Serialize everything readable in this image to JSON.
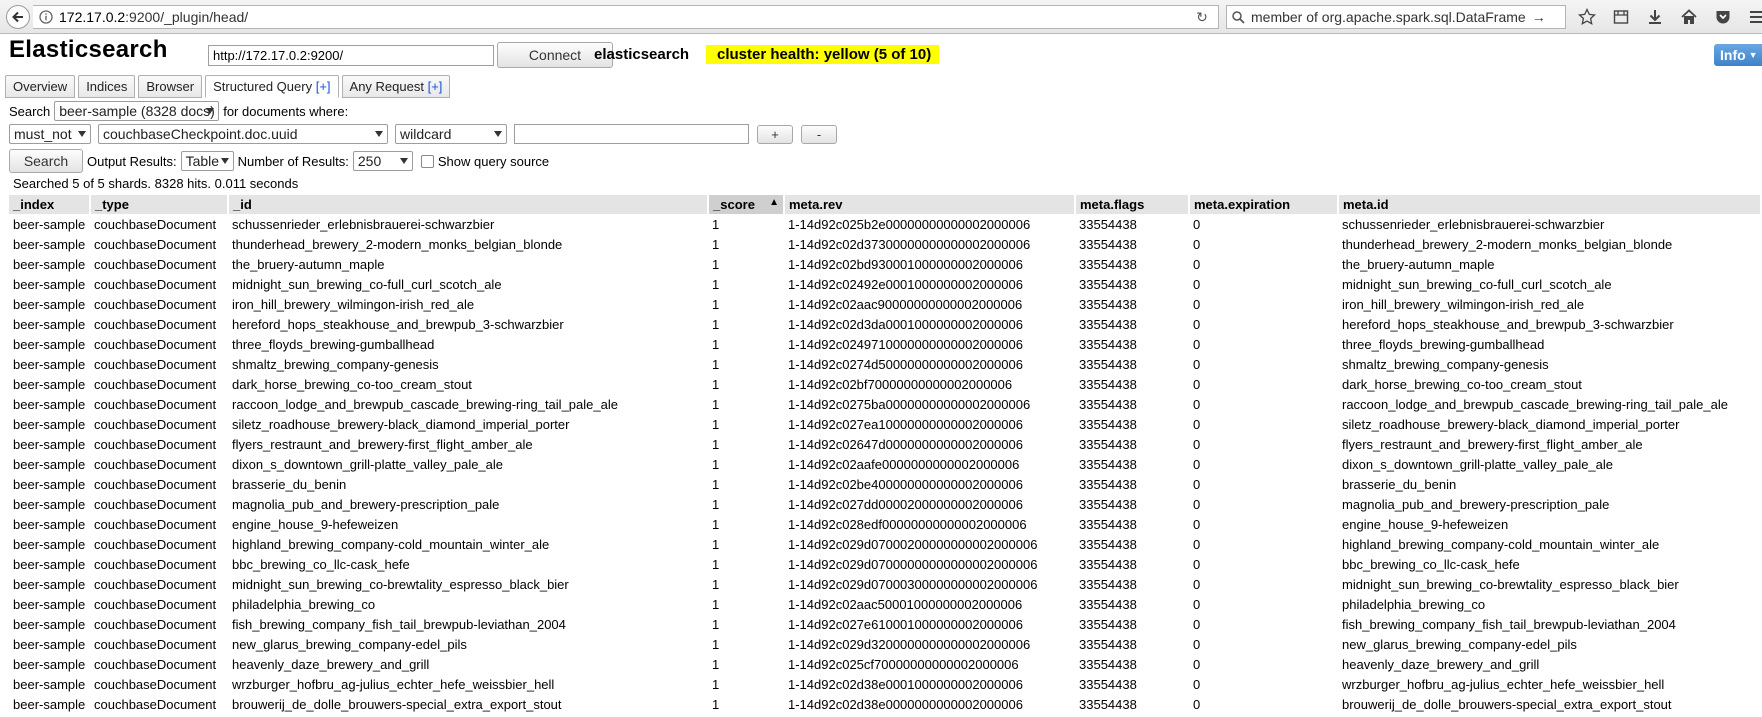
{
  "browser": {
    "url_host": "172.17.0.2",
    "url_rest": ":9200/_plugin/head/",
    "search_text": "member of org.apache.spark.sql.DataFrame",
    "search_arrow": "→"
  },
  "app": {
    "title": "Elasticsearch",
    "connection_url": "http://172.17.0.2:9200/",
    "connect_label": "Connect",
    "cluster_name": "elasticsearch",
    "health_text": "cluster health: yellow (5 of 10)",
    "health_color": "#ffff00",
    "info_label": "Info"
  },
  "tabs": [
    {
      "label": "Overview"
    },
    {
      "label": "Indices"
    },
    {
      "label": "Browser"
    },
    {
      "label": "Structured Query",
      "plus": "[+]"
    },
    {
      "label": "Any Request",
      "plus": "[+]"
    }
  ],
  "query": {
    "search_label": "Search",
    "index_value": "beer-sample (8328 docs)",
    "for_docs_label": "for documents where:",
    "bool_value": "must_not",
    "field_value": "couchbaseCheckpoint.doc.uuid",
    "op_value": "wildcard",
    "term_value": "",
    "add_label": "+",
    "remove_label": "-",
    "search_button": "Search",
    "output_label": "Output Results:",
    "output_value": "Table",
    "num_label": "Number of Results:",
    "num_value": "250",
    "show_source_label": "Show query source"
  },
  "summary": "Searched 5 of 5 shards. 8328 hits. 0.011 seconds",
  "table": {
    "columns": [
      "_index",
      "_type",
      "_id",
      "_score",
      "meta.rev",
      "meta.flags",
      "meta.expiration",
      "meta.id"
    ],
    "sort_indicator": "▲",
    "rows": [
      [
        "beer-sample",
        "couchbaseDocument",
        "schussenrieder_erlebnisbrauerei-schwarzbier",
        "1",
        "1-14d92c025b2e00000000000002000006",
        "33554438",
        "0",
        "schussenrieder_erlebnisbrauerei-schwarzbier"
      ],
      [
        "beer-sample",
        "couchbaseDocument",
        "thunderhead_brewery_2-modern_monks_belgian_blonde",
        "1",
        "1-14d92c02d37300000000000002000006",
        "33554438",
        "0",
        "thunderhead_brewery_2-modern_monks_belgian_blonde"
      ],
      [
        "beer-sample",
        "couchbaseDocument",
        "the_bruery-autumn_maple",
        "1",
        "1-14d92c02bd930001000000002000006",
        "33554438",
        "0",
        "the_bruery-autumn_maple"
      ],
      [
        "beer-sample",
        "couchbaseDocument",
        "midnight_sun_brewing_co-full_curl_scotch_ale",
        "1",
        "1-14d92c02492e0001000000002000006",
        "33554438",
        "0",
        "midnight_sun_brewing_co-full_curl_scotch_ale"
      ],
      [
        "beer-sample",
        "couchbaseDocument",
        "iron_hill_brewery_wilmingon-irish_red_ale",
        "1",
        "1-14d92c02aac90000000000002000006",
        "33554438",
        "0",
        "iron_hill_brewery_wilmingon-irish_red_ale"
      ],
      [
        "beer-sample",
        "couchbaseDocument",
        "hereford_hops_steakhouse_and_brewpub_3-schwarzbier",
        "1",
        "1-14d92c02d3da0001000000002000006",
        "33554438",
        "0",
        "hereford_hops_steakhouse_and_brewpub_3-schwarzbier"
      ],
      [
        "beer-sample",
        "couchbaseDocument",
        "three_floyds_brewing-gumballhead",
        "1",
        "1-14d92c0249710000000000002000006",
        "33554438",
        "0",
        "three_floyds_brewing-gumballhead"
      ],
      [
        "beer-sample",
        "couchbaseDocument",
        "shmaltz_brewing_company-genesis",
        "1",
        "1-14d92c0274d50000000000002000006",
        "33554438",
        "0",
        "shmaltz_brewing_company-genesis"
      ],
      [
        "beer-sample",
        "couchbaseDocument",
        "dark_horse_brewing_co-too_cream_stout",
        "1",
        "1-14d92c02bf70000000000002000006",
        "33554438",
        "0",
        "dark_horse_brewing_co-too_cream_stout"
      ],
      [
        "beer-sample",
        "couchbaseDocument",
        "raccoon_lodge_and_brewpub_cascade_brewing-ring_tail_pale_ale",
        "1",
        "1-14d92c0275ba00000000000002000006",
        "33554438",
        "0",
        "raccoon_lodge_and_brewpub_cascade_brewing-ring_tail_pale_ale"
      ],
      [
        "beer-sample",
        "couchbaseDocument",
        "siletz_roadhouse_brewery-black_diamond_imperial_porter",
        "1",
        "1-14d92c027ea10000000000002000006",
        "33554438",
        "0",
        "siletz_roadhouse_brewery-black_diamond_imperial_porter"
      ],
      [
        "beer-sample",
        "couchbaseDocument",
        "flyers_restraunt_and_brewery-first_flight_amber_ale",
        "1",
        "1-14d92c02647d0000000000002000006",
        "33554438",
        "0",
        "flyers_restraunt_and_brewery-first_flight_amber_ale"
      ],
      [
        "beer-sample",
        "couchbaseDocument",
        "dixon_s_downtown_grill-platte_valley_pale_ale",
        "1",
        "1-14d92c02aafe0000000000002000006",
        "33554438",
        "0",
        "dixon_s_downtown_grill-platte_valley_pale_ale"
      ],
      [
        "beer-sample",
        "couchbaseDocument",
        "brasserie_du_benin",
        "1",
        "1-14d92c02be400000000000002000006",
        "33554438",
        "0",
        "brasserie_du_benin"
      ],
      [
        "beer-sample",
        "couchbaseDocument",
        "magnolia_pub_and_brewery-prescription_pale",
        "1",
        "1-14d92c027dd00002000000002000006",
        "33554438",
        "0",
        "magnolia_pub_and_brewery-prescription_pale"
      ],
      [
        "beer-sample",
        "couchbaseDocument",
        "engine_house_9-hefeweizen",
        "1",
        "1-14d92c028edf00000000000002000006",
        "33554438",
        "0",
        "engine_house_9-hefeweizen"
      ],
      [
        "beer-sample",
        "couchbaseDocument",
        "highland_brewing_company-cold_mountain_winter_ale",
        "1",
        "1-14d92c029d07000200000000002000006",
        "33554438",
        "0",
        "highland_brewing_company-cold_mountain_winter_ale"
      ],
      [
        "beer-sample",
        "couchbaseDocument",
        "bbc_brewing_co_llc-cask_hefe",
        "1",
        "1-14d92c029d07000000000000002000006",
        "33554438",
        "0",
        "bbc_brewing_co_llc-cask_hefe"
      ],
      [
        "beer-sample",
        "couchbaseDocument",
        "midnight_sun_brewing_co-brewtality_espresso_black_bier",
        "1",
        "1-14d92c029d07000300000000002000006",
        "33554438",
        "0",
        "midnight_sun_brewing_co-brewtality_espresso_black_bier"
      ],
      [
        "beer-sample",
        "couchbaseDocument",
        "philadelphia_brewing_co",
        "1",
        "1-14d92c02aac50001000000002000006",
        "33554438",
        "0",
        "philadelphia_brewing_co"
      ],
      [
        "beer-sample",
        "couchbaseDocument",
        "fish_brewing_company_fish_tail_brewpub-leviathan_2004",
        "1",
        "1-14d92c027e610001000000002000006",
        "33554438",
        "0",
        "fish_brewing_company_fish_tail_brewpub-leviathan_2004"
      ],
      [
        "beer-sample",
        "couchbaseDocument",
        "new_glarus_brewing_company-edel_pils",
        "1",
        "1-14d92c029d3200000000000002000006",
        "33554438",
        "0",
        "new_glarus_brewing_company-edel_pils"
      ],
      [
        "beer-sample",
        "couchbaseDocument",
        "heavenly_daze_brewery_and_grill",
        "1",
        "1-14d92c025cf70000000000002000006",
        "33554438",
        "0",
        "heavenly_daze_brewery_and_grill"
      ],
      [
        "beer-sample",
        "couchbaseDocument",
        "wrzburger_hofbru_ag-julius_echter_hefe_weissbier_hell",
        "1",
        "1-14d92c02d38e0001000000002000006",
        "33554438",
        "0",
        "wrzburger_hofbru_ag-julius_echter_hefe_weissbier_hell"
      ],
      [
        "beer-sample",
        "couchbaseDocument",
        "brouwerij_de_dolle_brouwers-special_extra_export_stout",
        "1",
        "1-14d92c02d38e0000000000002000006",
        "33554438",
        "0",
        "brouwerij_de_dolle_brouwers-special_extra_export_stout"
      ]
    ]
  }
}
